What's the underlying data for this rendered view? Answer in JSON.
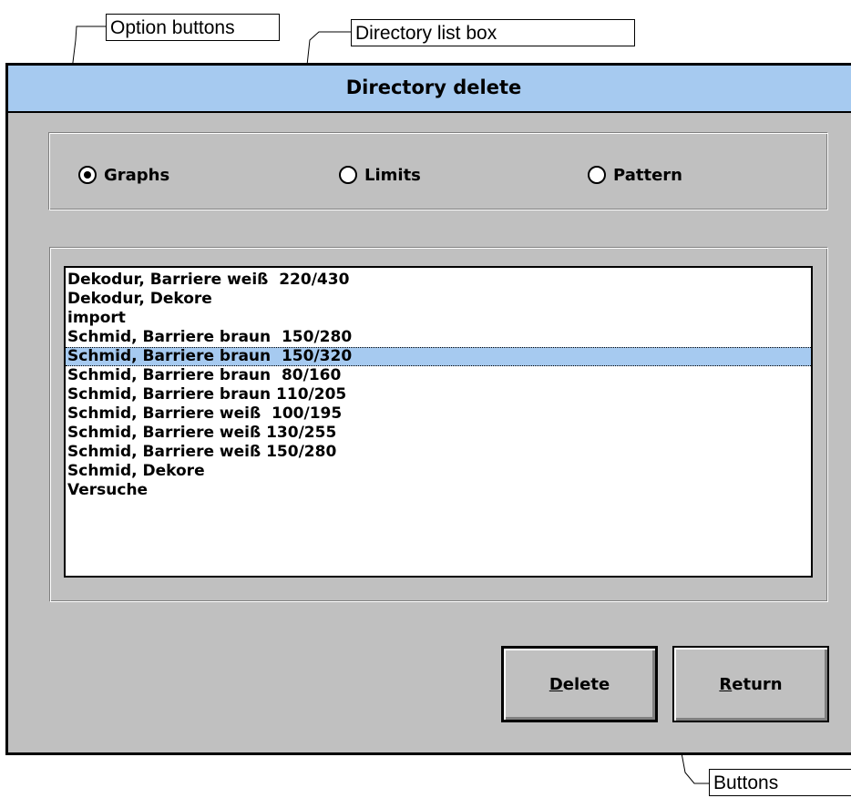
{
  "annotations": {
    "option_buttons": "Option buttons",
    "directory_list_box": "Directory list box",
    "buttons": "Buttons"
  },
  "window": {
    "title": "Directory delete"
  },
  "options": [
    {
      "label": "Graphs",
      "checked": true
    },
    {
      "label": "Limits",
      "checked": false
    },
    {
      "label": "Pattern",
      "checked": false
    }
  ],
  "directories": [
    "Dekodur, Barriere weiß  220/430",
    "Dekodur, Dekore",
    "import",
    "Schmid, Barriere braun  150/280",
    "Schmid, Barriere braun  150/320",
    "Schmid, Barriere braun  80/160",
    "Schmid, Barriere braun 110/205",
    "Schmid, Barriere weiß  100/195",
    "Schmid, Barriere weiß 130/255",
    "Schmid, Barriere weiß 150/280",
    "Schmid, Dekore",
    "Versuche"
  ],
  "selected_directory": "Schmid, Barriere braun  150/320",
  "buttons": {
    "delete": {
      "mnemonic": "D",
      "rest": "elete"
    },
    "return": {
      "mnemonic": "R",
      "rest": "eturn"
    }
  },
  "colors": {
    "titlebar": "#a6caf0",
    "selection": "#a6caf0",
    "face": "#c0c0c0"
  }
}
